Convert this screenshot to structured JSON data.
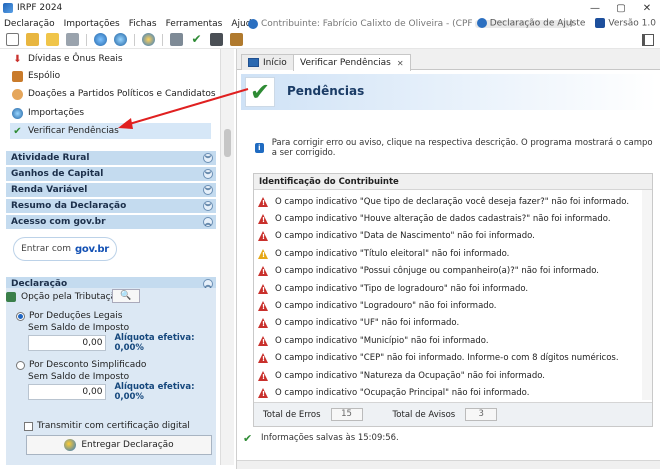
{
  "window": {
    "title": "IRPF 2024",
    "controls": {
      "minimize": "—",
      "maximize": "▢",
      "close": "✕"
    }
  },
  "menu": {
    "items": [
      "Declaração",
      "Importações",
      "Fichas",
      "Ferramentas",
      "Ajuda"
    ],
    "contributor": "Contribuinte: Fabrício Calixto de Oliveira - (CPF",
    "contributor_end": ")",
    "declaration_type": "Declaração de Ajuste",
    "version": "Versão 1.0"
  },
  "nav": {
    "items": [
      {
        "label": "Dívidas e Ônus Reais",
        "icon": "arrow-down-icon"
      },
      {
        "label": "Espólio",
        "icon": "estate-icon"
      },
      {
        "label": "Doações a Partidos Políticos e Candidatos",
        "icon": "person-icon"
      },
      {
        "label": "Importações",
        "icon": "import-icon"
      },
      {
        "label": "Verificar Pendências",
        "icon": "check-icon"
      }
    ],
    "sections": [
      {
        "label": "Atividade Rural",
        "chevron": "︾"
      },
      {
        "label": "Ganhos de Capital",
        "chevron": "︾"
      },
      {
        "label": "Renda Variável",
        "chevron": "︾"
      },
      {
        "label": "Resumo da Declaração",
        "chevron": "︾"
      },
      {
        "label": "Acesso com gov.br",
        "chevron": "︽"
      }
    ],
    "govbr_button": {
      "label": "Entrar com",
      "brand": "gov.br"
    },
    "declaration_section": {
      "label": "Declaração",
      "chevron": "︽"
    }
  },
  "declaration": {
    "option_label": "Opção pela Tributação:",
    "search_icon": "🔍",
    "legal": {
      "label": "Por Deduções Legais",
      "sublabel": "Sem Saldo de Imposto",
      "amount": "0,00",
      "rate": "Alíquota efetiva: 0,00%",
      "selected": true
    },
    "simplified": {
      "label": "Por Desconto Simplificado",
      "sublabel": "Sem Saldo de Imposto",
      "amount": "0,00",
      "rate": "Alíquota efetiva: 0,00%",
      "selected": false
    },
    "certificate_label": "Transmitir com certificação digital",
    "submit_label": "Entregar Declaração"
  },
  "tabs": [
    {
      "label": "Início"
    },
    {
      "label": "Verificar Pendências",
      "close": "✕"
    }
  ],
  "page": {
    "check_glyph": "✔",
    "title": "Pendências",
    "info_icon": "i",
    "info": "Para corrigir erro ou aviso, clique na respectiva descrição. O programa mostrará o campo a ser corrigido."
  },
  "pendencias": {
    "header": "Identificação do Contribuinte",
    "rows": [
      {
        "text": "O campo indicativo \"Que tipo de declaração você deseja fazer?\" não foi informado.",
        "level": "error"
      },
      {
        "text": "O campo indicativo \"Houve alteração de dados cadastrais?\" não foi informado.",
        "level": "error"
      },
      {
        "text": "O campo indicativo \"Data de Nascimento\" não foi informado.",
        "level": "error"
      },
      {
        "text": "O campo indicativo \"Título eleitoral\" não foi informado.",
        "level": "warning"
      },
      {
        "text": "O campo indicativo \"Possui cônjuge ou companheiro(a)?\" não foi informado.",
        "level": "error"
      },
      {
        "text": "O campo indicativo \"Tipo de logradouro\" não foi informado.",
        "level": "error"
      },
      {
        "text": "O campo indicativo \"Logradouro\" não foi informado.",
        "level": "error"
      },
      {
        "text": "O campo indicativo \"UF\" não foi informado.",
        "level": "error"
      },
      {
        "text": "O campo indicativo \"Município\" não foi informado.",
        "level": "error"
      },
      {
        "text": "O campo indicativo \"CEP\" não foi informado. Informe-o com 8 dígitos numéricos.",
        "level": "error"
      },
      {
        "text": "O campo indicativo \"Natureza da Ocupação\" não foi informado.",
        "level": "error"
      },
      {
        "text": "O campo indicativo \"Ocupação Principal\" não foi informado.",
        "level": "error"
      }
    ],
    "total_errors_label": "Total de Erros",
    "total_errors": "15",
    "total_warnings_label": "Total de Avisos",
    "total_warnings": "3"
  },
  "status": {
    "icon": "✔",
    "text": "Informações salvas às 15:09:56."
  },
  "colors": {
    "section_bg": "#c4dbef",
    "panel_bg": "#dce8f4",
    "error": "#c9302c",
    "warning": "#e6a817",
    "accent": "#1f6bc1",
    "arrow": "#e02020"
  }
}
